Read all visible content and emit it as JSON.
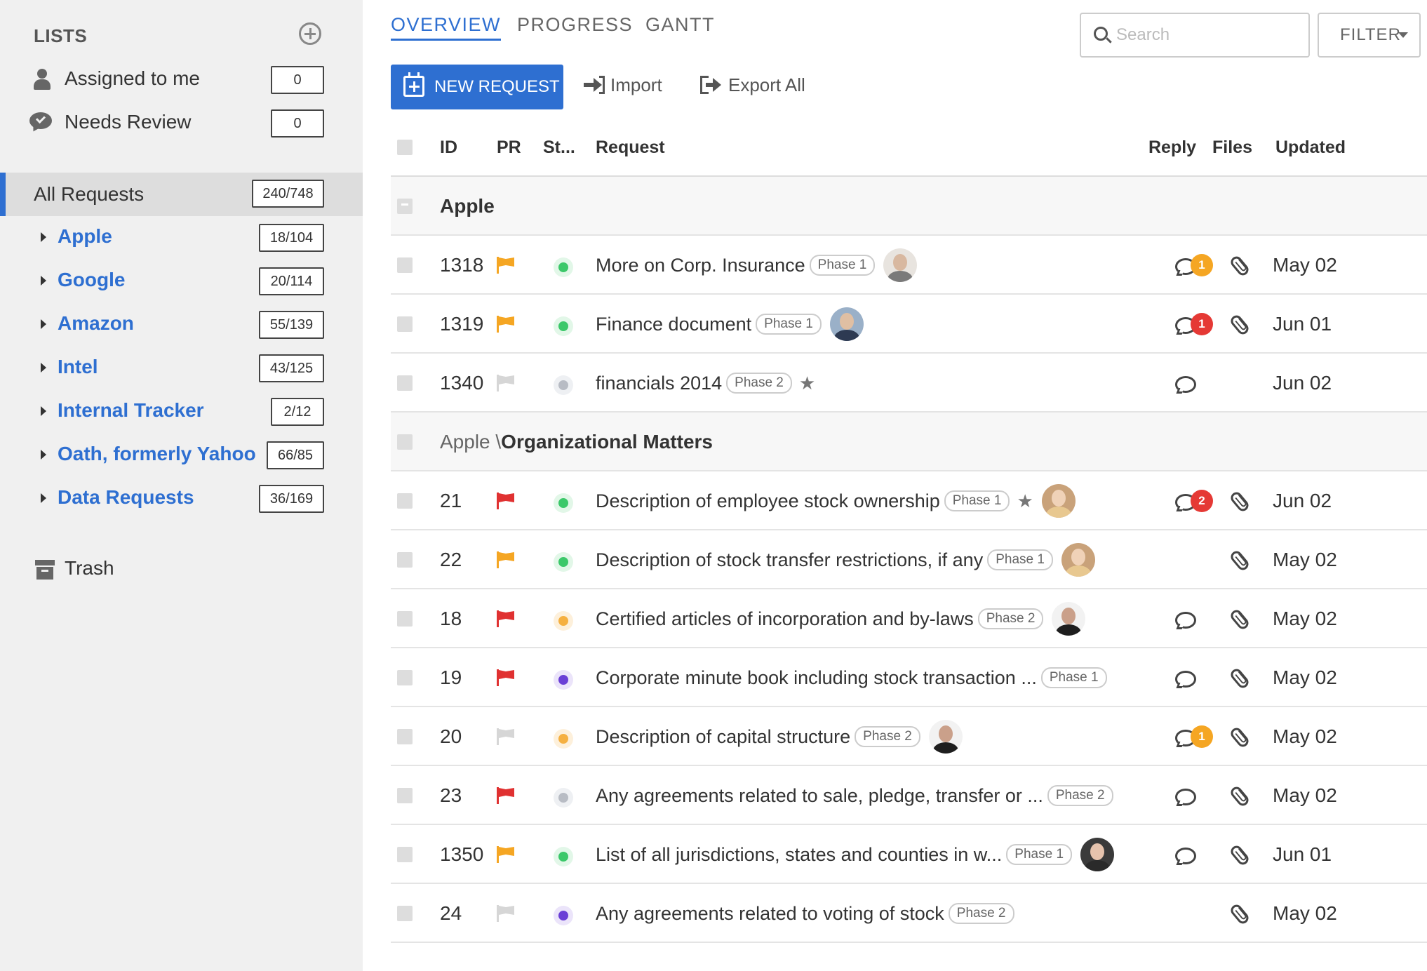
{
  "sidebar": {
    "lists_label": "LISTS",
    "assigned": {
      "label": "Assigned to me",
      "count": "0"
    },
    "review": {
      "label": "Needs Review",
      "count": "0"
    },
    "all_requests": {
      "label": "All Requests",
      "count": "240/748"
    },
    "clients": [
      {
        "label": "Apple",
        "count": "18/104"
      },
      {
        "label": "Google",
        "count": "20/114"
      },
      {
        "label": "Amazon",
        "count": "55/139"
      },
      {
        "label": "Intel",
        "count": "43/125"
      },
      {
        "label": "Internal Tracker",
        "count": "2/12"
      },
      {
        "label": "Oath, formerly Yahoo",
        "count": "66/85"
      },
      {
        "label": "Data Requests",
        "count": "36/169"
      }
    ],
    "trash_label": "Trash"
  },
  "tabs": [
    "OVERVIEW",
    "PROGRESS",
    "GANTT"
  ],
  "search": {
    "placeholder": "Search"
  },
  "filter_label": "FILTER",
  "toolbar": {
    "new_request": "NEW REQUEST",
    "import": "Import",
    "export": "Export All"
  },
  "columns": {
    "id": "ID",
    "pr": "PR",
    "status": "St...",
    "request": "Request",
    "reply": "Reply",
    "files": "Files",
    "updated": "Updated"
  },
  "colors": {
    "accent": "#2e6fd1",
    "flag_orange": "#f5a623",
    "flag_red": "#e03131",
    "flag_none": "#d6d6d6",
    "status_green": "#3cc86a",
    "status_grey": "#b8bcc4",
    "status_orange": "#f5b041",
    "status_purple": "#6a3fd6",
    "badge_orange": "#f5a623",
    "badge_red": "#e53935"
  },
  "groups": [
    {
      "prefix": "",
      "name": "Apple",
      "rows": [
        {
          "id": "1318",
          "flag": "orange",
          "status": "green",
          "request": "More on Corp. Insurance",
          "phase": "Phase 1",
          "star": false,
          "avatar": "man-glasses",
          "reply": "badge",
          "reply_count": "1",
          "badge_color": "orange",
          "files": true,
          "updated": "May 02"
        },
        {
          "id": "1319",
          "flag": "orange",
          "status": "green",
          "request": "Finance document",
          "phase": "Phase 1",
          "star": false,
          "avatar": "man-suit",
          "reply": "badge",
          "reply_count": "1",
          "badge_color": "red",
          "files": true,
          "updated": "Jun 01"
        },
        {
          "id": "1340",
          "flag": "none",
          "status": "grey",
          "request": "financials 2014",
          "phase": "Phase 2",
          "star": true,
          "avatar": "",
          "reply": "plain",
          "reply_count": "",
          "badge_color": "",
          "files": false,
          "updated": "Jun 02"
        }
      ]
    },
    {
      "prefix": "Apple \\",
      "name": "Organizational Matters",
      "rows": [
        {
          "id": "21",
          "flag": "red",
          "status": "green",
          "request": "Description of employee stock ownership",
          "phase": "Phase 1",
          "star": true,
          "avatar": "woman-blonde",
          "reply": "badge",
          "reply_count": "2",
          "badge_color": "red",
          "files": true,
          "updated": "Jun 02"
        },
        {
          "id": "22",
          "flag": "orange",
          "status": "green",
          "request": "Description of stock transfer restrictions, if any",
          "phase": "Phase 1",
          "star": false,
          "avatar": "woman-blonde",
          "reply": "none",
          "reply_count": "",
          "badge_color": "",
          "files": true,
          "updated": "May 02"
        },
        {
          "id": "18",
          "flag": "red",
          "status": "orange",
          "request": "Certified articles of incorporation and by-laws",
          "phase": "Phase 2",
          "star": false,
          "avatar": "man-dark",
          "reply": "plain",
          "reply_count": "",
          "badge_color": "",
          "files": true,
          "updated": "May 02"
        },
        {
          "id": "19",
          "flag": "red",
          "status": "purple",
          "request": "Corporate minute book including stock transaction ...",
          "phase": "Phase 1",
          "star": false,
          "avatar": "",
          "reply": "plain",
          "reply_count": "",
          "badge_color": "",
          "files": true,
          "updated": "May 02"
        },
        {
          "id": "20",
          "flag": "none",
          "status": "orange",
          "request": "Description of capital structure",
          "phase": "Phase 2",
          "star": false,
          "avatar": "man-dark",
          "reply": "badge",
          "reply_count": "1",
          "badge_color": "orange",
          "files": true,
          "updated": "May 02"
        },
        {
          "id": "23",
          "flag": "red",
          "status": "grey",
          "request": "Any agreements related to sale, pledge, transfer or ...",
          "phase": "Phase 2",
          "star": false,
          "avatar": "",
          "reply": "plain",
          "reply_count": "",
          "badge_color": "",
          "files": true,
          "updated": "May 02"
        },
        {
          "id": "1350",
          "flag": "orange",
          "status": "green",
          "request": "List of all jurisdictions, states and counties in w...",
          "phase": "Phase 1",
          "star": false,
          "avatar": "woman-dark",
          "reply": "plain",
          "reply_count": "",
          "badge_color": "",
          "files": true,
          "updated": "Jun 01"
        },
        {
          "id": "24",
          "flag": "none",
          "status": "purple",
          "request": "Any agreements related to voting of stock",
          "phase": "Phase 2",
          "star": false,
          "avatar": "",
          "reply": "none",
          "reply_count": "",
          "badge_color": "",
          "files": true,
          "updated": "May 02"
        }
      ]
    }
  ]
}
